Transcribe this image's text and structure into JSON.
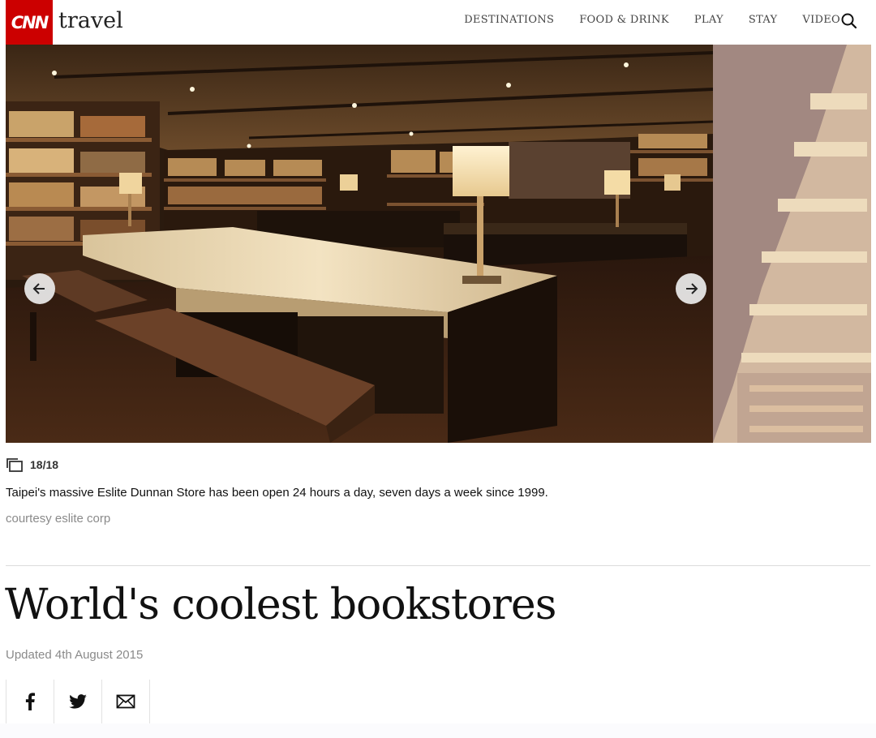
{
  "header": {
    "logo_text": "CNN",
    "section_title": "travel",
    "nav": [
      "DESTINATIONS",
      "FOOD & DRINK",
      "PLAY",
      "STAY",
      "VIDEO"
    ],
    "search_icon": "search-icon",
    "brand_color": "#cc0000"
  },
  "gallery": {
    "counter": "18/18",
    "caption": "Taipei's massive Eslite Dunnan Store has been open 24 hours a day, seven days a week since 1999.",
    "credit": "courtesy eslite corp",
    "prev_icon": "arrow-left-icon",
    "next_icon": "arrow-right-icon"
  },
  "article": {
    "headline": "World's coolest bookstores",
    "updated": "Updated 4th August 2015"
  },
  "share": {
    "icons": [
      "facebook-icon",
      "twitter-icon",
      "email-icon"
    ]
  }
}
